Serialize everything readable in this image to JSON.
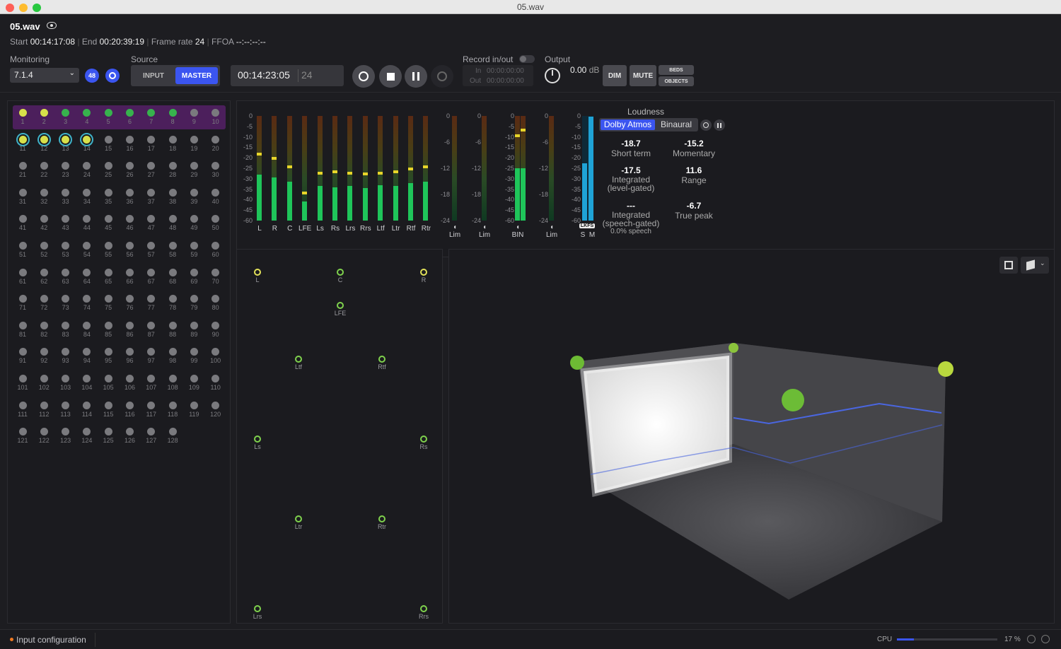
{
  "window": {
    "title": "05.wav"
  },
  "file": {
    "name": "05.wav",
    "start_label": "Start",
    "start": "00:14:17:08",
    "end_label": "End",
    "end": "00:20:39:19",
    "frame_rate_label": "Frame rate",
    "frame_rate": "24",
    "ffoa_label": "FFOA",
    "ffoa": "--:--:--:--"
  },
  "monitoring": {
    "label": "Monitoring",
    "format": "7.1.4",
    "badge": "48"
  },
  "source": {
    "label": "Source",
    "input": "INPUT",
    "master": "MASTER"
  },
  "transport": {
    "timecode": "00:14:23:05",
    "frames": "24"
  },
  "record": {
    "label": "Record in/out",
    "in_label": "In",
    "in_value": "00:00:00:00",
    "out_label": "Out",
    "out_value": "00:00:00:00"
  },
  "output": {
    "label": "Output",
    "value": "0.00",
    "unit": "dB",
    "dim": "DIM",
    "mute": "MUTE",
    "beds": "BEDS",
    "objects": "OBJECTS"
  },
  "meters": {
    "channels": [
      "L",
      "R",
      "C",
      "LFE",
      "Ls",
      "Rs",
      "Lrs",
      "Rrs",
      "Ltf",
      "Ltr",
      "Rtf",
      "Rtr"
    ],
    "scale": [
      "0",
      "-5",
      "-10",
      "-15",
      "-20",
      "-25",
      "-30",
      "-35",
      "-40",
      "-45",
      "-60"
    ],
    "scale_b": [
      "0",
      "-6",
      "-12",
      "-18",
      "-24"
    ],
    "levels": [
      0.44,
      0.41,
      0.37,
      0.18,
      0.33,
      0.32,
      0.33,
      0.31,
      0.34,
      0.33,
      0.36,
      0.37
    ],
    "peaks": [
      0.62,
      0.58,
      0.5,
      0.25,
      0.44,
      0.45,
      0.44,
      0.43,
      0.44,
      0.45,
      0.48,
      0.5
    ],
    "lim1": "Lim",
    "lim2": "Lim",
    "bin": "BIN",
    "lim3": "Lim",
    "lkfs": "LKFS",
    "s": "S",
    "m": "M"
  },
  "loudness": {
    "title": "Loudness",
    "tab_active": "Dolby Atmos",
    "tab_other": "Binaural",
    "short_term_value": "-18.7",
    "short_term_label": "Short term",
    "momentary_value": "-15.2",
    "momentary_label": "Momentary",
    "integrated_value": "-17.5",
    "integrated_label": "Integrated",
    "integrated_sub": "(level-gated)",
    "range_value": "11.6",
    "range_label": "Range",
    "speech_value": "---",
    "speech_label": "Integrated",
    "speech_sub": "(speech-gated)",
    "speech_pct": "0.0% speech",
    "truepeak_value": "-6.7",
    "truepeak_label": "True peak"
  },
  "speakers": [
    "L",
    "C",
    "R",
    "LFE",
    "Ltf",
    "Rtf",
    "Ls",
    "Rs",
    "Ltr",
    "Rtr",
    "Lrs",
    "Rrs"
  ],
  "status": {
    "input_config": "Input configuration",
    "cpu_label": "CPU",
    "cpu_value": "17 %",
    "cpu_fraction": 0.17
  },
  "colors": {
    "accent": "#3b55f0",
    "meter_green": "#1fc55a",
    "meter_yellow": "#e8d52a",
    "channel_active_green": "#37b24d",
    "channel_active_yellow": "#d7e04a",
    "bed_highlight": "#4c1f5c"
  }
}
